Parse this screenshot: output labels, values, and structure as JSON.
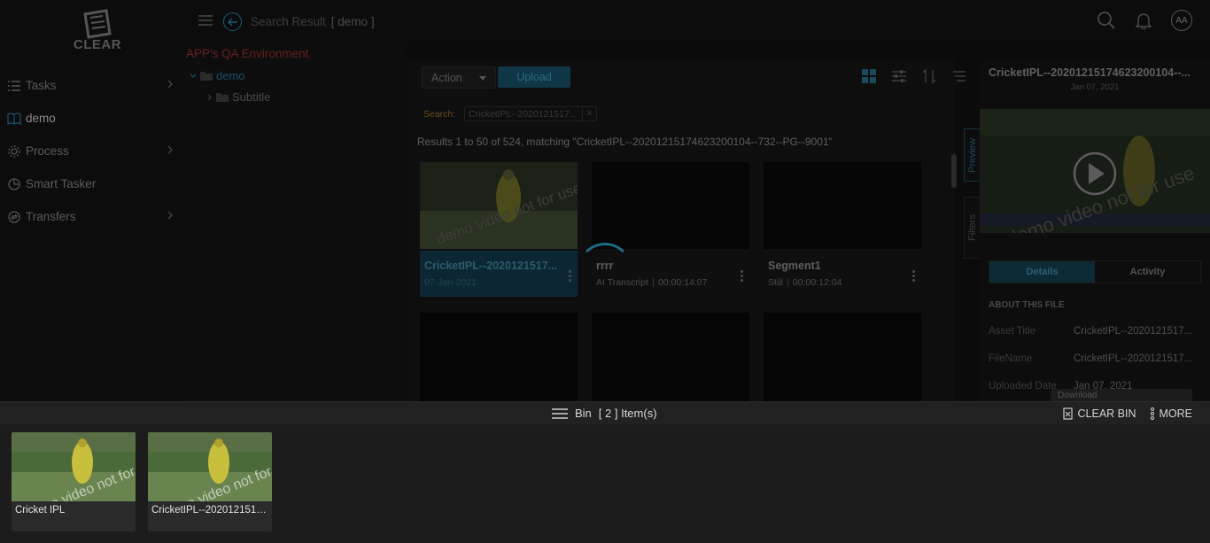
{
  "app": {
    "logo_text": "CLEAR"
  },
  "sidebar": {
    "items": [
      {
        "label": "Tasks",
        "icon": "list-icon",
        "has_chevron": true
      },
      {
        "label": "demo",
        "icon": "book-icon",
        "has_chevron": false
      },
      {
        "label": "Process",
        "icon": "gear-icon",
        "has_chevron": true
      },
      {
        "label": "Smart Tasker",
        "icon": "smart-tasker-icon",
        "has_chevron": false
      },
      {
        "label": "Transfers",
        "icon": "transfer-icon",
        "has_chevron": true
      }
    ]
  },
  "topbar": {
    "title": "Search Result",
    "context_tag": "[ demo ]",
    "avatar_initials": "AA"
  },
  "tree": {
    "env_label": "APP's QA Environment",
    "root_folder": "demo",
    "child_folder": "Subtitle"
  },
  "toolbar": {
    "action_label": "Action",
    "upload_label": "Upload"
  },
  "search": {
    "label": "Search:",
    "chip_value": "CricketIPL--2020121517...",
    "chip_close": "x",
    "results_text": "Results 1 to 50 of 524, matching \"CricketIPL--20201215174623200104--732--PG--9001\""
  },
  "cards": [
    {
      "title": "CricketIPL--2020121517...",
      "sub1": "07-Jan-2021",
      "sub2": ""
    },
    {
      "title": "rrrr",
      "sub1": "AI Transcript",
      "sub2": "00:00:14:07"
    },
    {
      "title": "Segment1",
      "sub1": "Still",
      "sub2": "00:00:12:04"
    }
  ],
  "side_tabs": {
    "preview": "Preview",
    "filters": "Filters"
  },
  "details": {
    "title": "CricketIPL--20201215174623200104--...",
    "date": "Jan 07, 2021",
    "tabs": [
      "Details",
      "Activity"
    ],
    "section": "ABOUT THIS FILE",
    "rows": [
      {
        "key": "Asset Title",
        "value": "CricketIPL--2020121517..."
      },
      {
        "key": "FileName",
        "value": "CricketIPL--2020121517..."
      },
      {
        "key": "Uploaded Date",
        "value": "Jan 07, 2021"
      }
    ],
    "download_popup": "Download"
  },
  "bin": {
    "title": "Bin",
    "count": "[ 2 ] Item(s)",
    "clear_label": "CLEAR BIN",
    "more_label": "MORE",
    "items": [
      {
        "label": "Cricket IPL"
      },
      {
        "label": "CricketIPL--2020121517..."
      }
    ]
  },
  "watermark": "demo video not for use",
  "colors": {
    "accent": "#1e6b85",
    "env_label": "#6b1f1f",
    "search_label": "#6a4c1e",
    "bin_bg": "#1c1c1c"
  }
}
